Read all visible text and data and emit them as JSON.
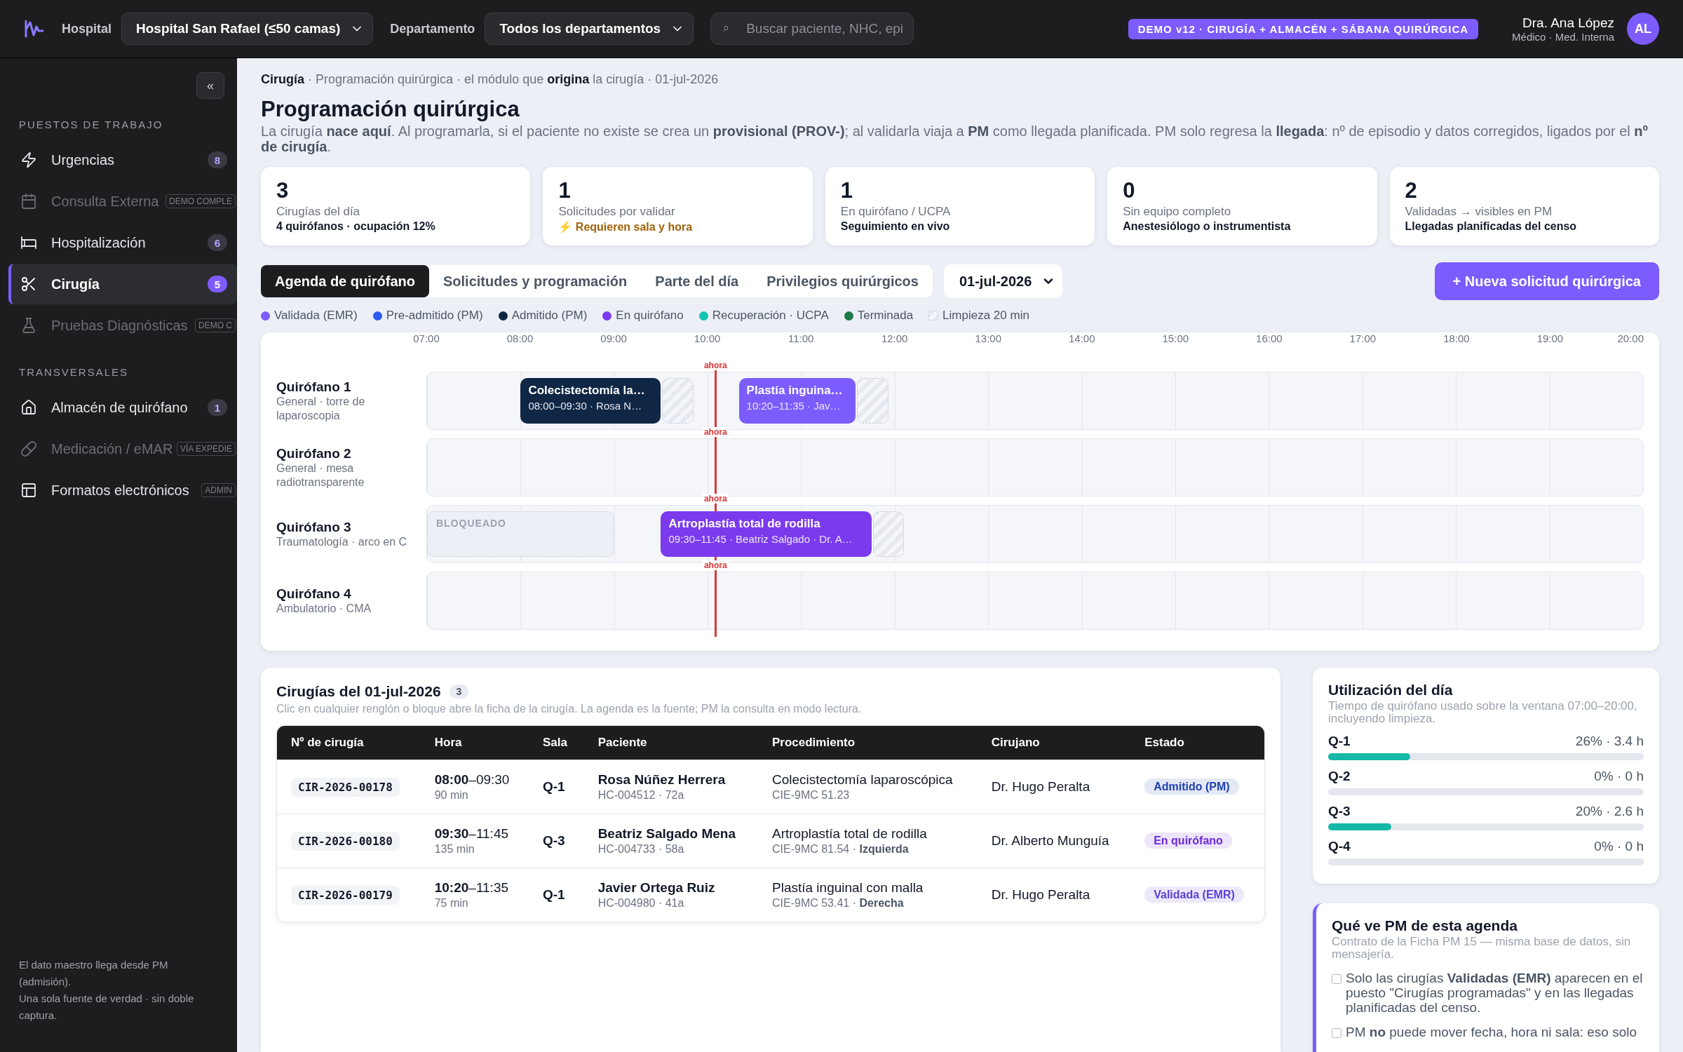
{
  "topbar": {
    "hospital_label": "Hospital",
    "hospital_select": "Hospital San Rafael (≤50 camas)",
    "department_label": "Departamento",
    "department_select": "Todos los departamentos",
    "search_icon": "⌕",
    "search_placeholder": "Buscar paciente, NHC, epi",
    "demo_badge": "DEMO v12 · CIRUGÍA + ALMACÉN + SÁBANA QUIRÚRGICA",
    "user_name": "Dra. Ana López",
    "user_role": "Médico · Med. Interna",
    "avatar": "AL"
  },
  "sidebar": {
    "collapse_button": "«",
    "sections": [
      {
        "title": "PUESTOS DE TRABAJO",
        "items": [
          {
            "label": "Urgencias",
            "badge": "8",
            "disabled": false,
            "selected": false
          },
          {
            "label": "Consulta Externa",
            "tag": "DEMO COMPLE",
            "disabled": true,
            "selected": false
          },
          {
            "label": "Hospitalización",
            "badge": "6",
            "disabled": false,
            "selected": false
          },
          {
            "label": "Cirugía",
            "badge": "5",
            "disabled": false,
            "selected": true
          },
          {
            "label": "Pruebas Diagnósticas",
            "tag": "DEMO C",
            "disabled": true,
            "selected": false
          }
        ]
      },
      {
        "title": "TRANSVERSALES",
        "items": [
          {
            "label": "Almacén de quirófano",
            "badge": "1",
            "disabled": false,
            "selected": false
          },
          {
            "label": "Medicación / eMAR",
            "tag": "VÍA EXPEDIE",
            "disabled": true,
            "selected": false
          },
          {
            "label": "Formatos electrónicos",
            "tag": "ADMIN",
            "disabled": false,
            "selected": false
          }
        ]
      }
    ],
    "footer": [
      "El dato maestro llega desde PM (admisión).",
      "Una sola fuente de verdad · sin doble captura."
    ]
  },
  "main": {
    "breadcrumb": "**Cirugía** · Programación quirúrgica · el módulo que **origina** la cirugía · 01-jul-2026",
    "title": "Programación quirúrgica",
    "description": "La cirugía **nace aquí**. Al programarla, si el paciente no existe se crea un **provisional (PROV-)**; al validarla viaja a **PM** como llegada planificada. PM solo regresa la **llegada**: nº de episodio y datos corregidos, ligados por el **nº de cirugía**.",
    "kpis": [
      {
        "value": "3",
        "label": "Cirugías del día",
        "note": "4 quirófanos · ocupación 12%",
        "kind": "normal"
      },
      {
        "value": "1",
        "label": "Solicitudes por validar",
        "note": "⚡ Requieren sala y hora",
        "kind": "warning"
      },
      {
        "value": "1",
        "label": "En quirófano / UCPA",
        "note": "Seguimiento en vivo",
        "kind": "normal"
      },
      {
        "value": "0",
        "label": "Sin equipo completo",
        "note": "Anestesiólogo o instrumentista",
        "kind": "normal"
      },
      {
        "value": "2",
        "label": "Validadas → visibles en PM",
        "note": "Llegadas planificadas del censo",
        "kind": "normal"
      }
    ],
    "tabs": [
      {
        "label": "Agenda de quirófano",
        "selected": true
      },
      {
        "label": "Solicitudes y programación",
        "selected": false
      },
      {
        "label": "Parte del día",
        "selected": false
      },
      {
        "label": "Privilegios quirúrgicos",
        "selected": false
      }
    ],
    "date_select": "01-jul-2026",
    "new_button": "+ Nueva solicitud quirúrgica",
    "legend": [
      {
        "label": "Validada (EMR)",
        "color": "#7c5cff",
        "kind": "dot"
      },
      {
        "label": "Pre-admitido (PM)",
        "color": "#2f5cf5",
        "kind": "dot"
      },
      {
        "label": "Admitido (PM)",
        "color": "#0f2744",
        "kind": "dot"
      },
      {
        "label": "En quirófano",
        "color": "#7c3aed",
        "kind": "dot"
      },
      {
        "label": "Recuperación · UCPA",
        "color": "#14c4b0",
        "kind": "dot"
      },
      {
        "label": "Terminada",
        "color": "#1e7a4a",
        "kind": "dot"
      },
      {
        "label": "Limpieza 20 min",
        "kind": "hatch"
      }
    ],
    "agenda": {
      "hours": [
        "07:00",
        "08:00",
        "09:00",
        "10:00",
        "11:00",
        "12:00",
        "13:00",
        "14:00",
        "15:00",
        "16:00",
        "17:00",
        "18:00",
        "19:00",
        "20:00"
      ],
      "rooms": [
        {
          "name": "Quirófano 1",
          "description": "General · torre de laparoscopia",
          "now_label": "ahora",
          "blocks": [
            {
              "kind": "surgery",
              "title": "Colecistectomía la…",
              "detail": "08:00–09:30 · Rosa N…",
              "color": "#0f2744",
              "cleaning": true
            },
            {
              "kind": "surgery",
              "title": "Plastía inguina…",
              "detail": "10:20–11:35 · Jav…",
              "color": "#7c5cff",
              "cleaning": true
            }
          ]
        },
        {
          "name": "Quirófano 2",
          "description": "General · mesa radiotransparente",
          "now_label": "ahora"
        },
        {
          "name": "Quirófano 3",
          "description": "Traumatología · arco en C",
          "now_label": "ahora",
          "blocks": [
            {
              "kind": "blocked",
              "title": "BLOQUEADO"
            },
            {
              "kind": "surgery",
              "title": "Artroplastía total de rodilla",
              "detail": "09:30–11:45 · Beatriz Salgado · Dr. A…",
              "color": "#7c3aed",
              "cleaning": true
            }
          ]
        },
        {
          "name": "Quirófano 4",
          "description": "Ambulatorio · CMA",
          "now_label": "ahora"
        }
      ]
    }
  },
  "surgeries": {
    "title": "Cirugías del 01-jul-2026",
    "count": "3",
    "subtitle": "Clic en cualquier renglón o bloque abre la ficha de la cirugía. La agenda es la fuente; PM la consulta en modo lectura.",
    "columns": [
      "Nº de cirugía",
      "Hora",
      "Sala",
      "Paciente",
      "Procedimiento",
      "Cirujano",
      "Estado"
    ],
    "rows": [
      {
        "id": "CIR-2026-00178",
        "time": "**08:00**–09:30",
        "duration": "90 min",
        "room": "Q-1",
        "patient": "Rosa Núñez Herrera",
        "patient_info": "HC-004512 · 72a",
        "procedure": "Colecistectomía laparoscópica",
        "procedure_code": "CIE-9MC 51.23",
        "surgeon": "Dr. Hugo Peralta",
        "status": "Admitido (PM)",
        "color": "#1e40af"
      },
      {
        "id": "CIR-2026-00180",
        "time": "**09:30**–11:45",
        "duration": "135 min",
        "room": "Q-3",
        "patient": "Beatriz Salgado Mena",
        "patient_info": "HC-004733 · 58a",
        "procedure": "Artroplastía total de rodilla",
        "procedure_code": "CIE-9MC 81.54 · **Izquierda**",
        "surgeon": "Dr. Alberto Munguía",
        "status": "En quirófano",
        "color": "#6d28d9"
      },
      {
        "id": "CIR-2026-00179",
        "time": "**10:20**–11:35",
        "duration": "75 min",
        "room": "Q-1",
        "patient": "Javier Ortega Ruiz",
        "patient_info": "HC-004980 · 41a",
        "procedure": "Plastía inguinal con malla",
        "procedure_code": "CIE-9MC 53.41 · **Derecha**",
        "surgeon": "Dr. Hugo Peralta",
        "status": "Validada (EMR)",
        "color": "#5b3fd6"
      }
    ]
  },
  "utilization": {
    "title": "Utilización del día",
    "subtitle": "Tiempo de quirófano usado sobre la ventana 07:00–20:00, incluyendo limpieza.",
    "rooms": [
      {
        "name": "Q-1",
        "reading": "26% · 3.4 h",
        "level": 0.26
      },
      {
        "name": "Q-2",
        "reading": "0% · 0 h",
        "level": 0
      },
      {
        "name": "Q-3",
        "reading": "20% · 2.6 h",
        "level": 0.2
      },
      {
        "name": "Q-4",
        "reading": "0% · 0 h",
        "level": 0
      }
    ]
  },
  "pm_view": {
    "title": "Qué ve PM de esta agenda",
    "subtitle": "Contrato de la Ficha PM 15 — misma base de datos, sin mensajería.",
    "items": [
      "Solo las cirugías **Validadas (EMR)** aparecen en el puesto \"Cirugías programadas\" y en las llegadas planificadas del censo.",
      "PM **no** puede mover fecha, hora ni sala: eso solo"
    ]
  }
}
